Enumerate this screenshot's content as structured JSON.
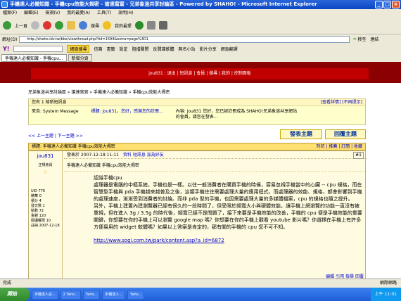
{
  "window": {
    "title": "手機達人必備知識 - 手機cpu效能大揭密 - 搶達寫寫 - 兄弟象迷共享討論區 - Powered by SHAHO! - Microsoft Internet Explorer"
  },
  "menu": [
    "檔案(F)",
    "編輯(E)",
    "檢視(V)",
    "我的最愛(A)",
    "工具(T)",
    "說明(H)"
  ],
  "toolbar": {
    "back": "上一頁",
    "search": "搜尋",
    "favorites": "我的最愛"
  },
  "address": {
    "label": "網址(D)",
    "url": "http://shaho.idv.tw/bbs/viewthread.php?tid=1594&extra=page%3D1",
    "go": "移至",
    "links": "連結"
  },
  "linksbar": {
    "yahoo": "Y!",
    "search": "網頁搜尋",
    "mail": "信箱",
    "book": "書籤",
    "settings": "設定",
    "block": "阻擋關閉",
    "spyware": "反間諜軟體",
    "store": "無名小站",
    "share": "影片分享",
    "translate": "網頁翻譯"
  },
  "tabs": [
    {
      "label": "手機達人必備知識 - 手機cpu..."
    },
    {
      "label": "新增分頁"
    }
  ],
  "forum": {
    "topbar": "jou831 : 退出 | 短訊息 | 會員 | 搜尋 | 我的 | 控制面板",
    "breadcrumb": "兄弟象迷共享討論區 » 搶達寫寫 » 手機達人必備知識 » 手機cpu效能大揭密",
    "msgbox_title": "您有 1 條新短訊息",
    "msgbox_actions": "[查看詳情] [不再提示]",
    "msg_from": "來自: System Message",
    "msg_subject": "標題: jou831，您好，感謝您的註冊...",
    "msg_content": "內容: jou831 您好，您已經註冊成為 SHAHO!兄弟象迷共享網站 的會員，請您在發表...",
    "topicnav": "<< 上一主題 | 下一主題 >>",
    "post_button": "發表主題",
    "reply_button": "回覆主題",
    "thread_title": "標題: 手機達人必備知識 手機cpu效能大揭密",
    "thread_actions": "列印 | 推薦 | 訂閱 | 收藏",
    "author": "jou831",
    "role": "正規會員",
    "stars": "☆",
    "stats": [
      "UID 776",
      "精華 0",
      "積分 4",
      "發文數 1",
      "點數 72",
      "金錢 120",
      "閱讀權限 10",
      "註冊 2007-12-18"
    ],
    "post_meta": "發表於 2007-12-18 11:11",
    "post_links": "資料 短訊息 加為好友",
    "post_number": "#1",
    "post_subject": "手機達人必備知識 手機cpu效能大揭密",
    "post_body": [
      "認識手機cpu",
      "處理器是電腦的中樞系統，手機也是一樣。以往一般消費者在購買手機的時候，容易忽視手機當中的心臟 -- cpu 規格，而在智慧型手機與 pda 手機越來越普及之後，這類手機往往需要處理大量的應用程式，而處理器的效能、規格，都會影響到手機的處理速度，漸漸受到消費者的討論。而非 pda 型的手機，也因需要處理大量的多媒體檔案，cpu 的規格也隨之提升。",
      "另外，手機上建置內建瀏覽器已經有很久的一段時間了，但受限於頻寬大小與硬體效能，讓手機上網瀏覽的功能一直沒有被重視，但在進入 3g / 3.5g 的時代後，頻寬已經不是問題了，接下來要是手機效能的改善，手機的 cpu 便是手機效能的重要關鍵，你想要在你的手機上可以瀏覽 google map 嗎？你想要在你的手機上觀看 youtube 影片嗎？你選擇在手機上有許多方便易用的 widget 軟體嗎？如果以上答案是肯定的，那有關的手機的 cpu 您不可不知。"
    ],
    "post_url": "http://www.sogi.com.tw/park/content.asp?a_id=6872",
    "post_actions": "編輯 引用 檢舉 回覆"
  },
  "status": {
    "left": "完成",
    "zone": "網際網路"
  },
  "taskbar": {
    "start": "開始",
    "tasks": [
      "手機達人必...",
      "2 Yaho...",
      "Yaho...",
      "手機達人...",
      "Yaho..."
    ],
    "clock": "上午 11:01"
  }
}
